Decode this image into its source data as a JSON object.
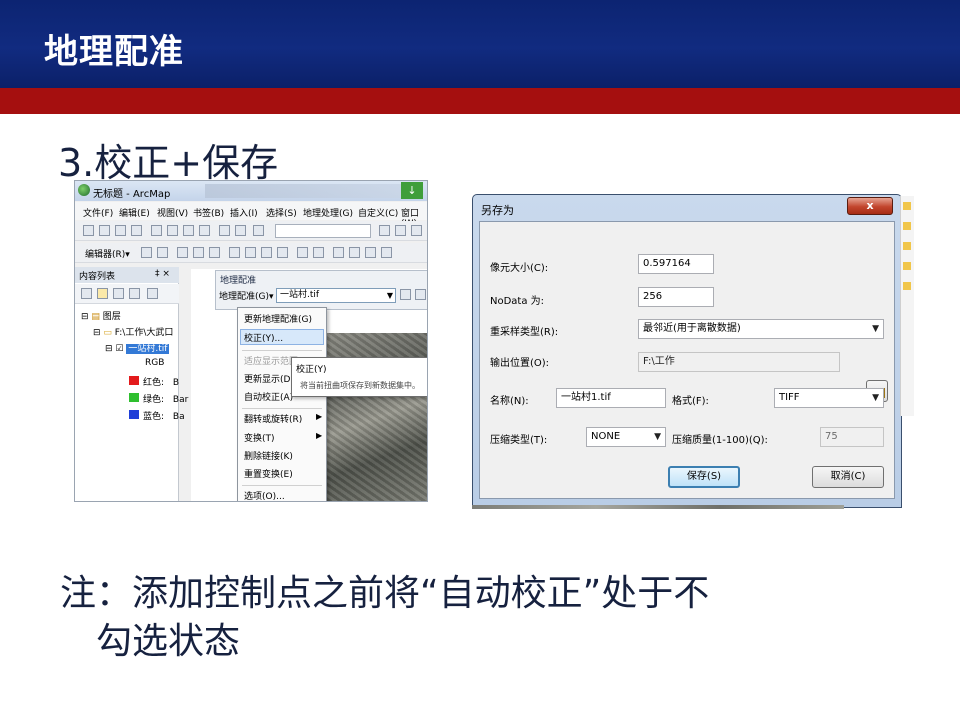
{
  "slide": {
    "title": "地理配准",
    "subtitle": "3.校正+保存",
    "note_line1": "注：添加控制点之前将“自动校正”处于不",
    "note_line2": "勾选状态",
    "colors": {
      "header": "#112b80",
      "band": "#a50f0f",
      "text": "#16213f"
    }
  },
  "arcmap": {
    "window_title": "无标题 - ArcMap",
    "menu": [
      "文件(F)",
      "编辑(E)",
      "视图(V)",
      "书签(B)",
      "插入(I)",
      "选择(S)",
      "地理处理(G)",
      "自定义(C)",
      "窗口(W)"
    ],
    "editor_label": "编辑器(R)▾",
    "toc": {
      "header": "内容列表",
      "pin": "‡ ×",
      "layers": "图层",
      "folder": "F:\\工作\\大武口",
      "raster": "一站村.tif",
      "rgb": "RGB",
      "bands": [
        {
          "label": "红色:",
          "value": "B",
          "color": "#e31a1c"
        },
        {
          "label": "绿色:",
          "value": "Bar",
          "color": "#2fbf2f"
        },
        {
          "label": "蓝色:",
          "value": "Ba",
          "color": "#1f3fd8"
        }
      ]
    },
    "georef": {
      "toolbar_title": "地理配准",
      "button": "地理配准(G)▾",
      "layer_combo": "一站村.tif",
      "menu_items": [
        "更新地理配准(G)",
        "校正(Y)...",
        "适应显示范围",
        "更新显示(D)",
        "自动校正(A)",
        "翻转或旋转(R)",
        "变换(T)",
        "删除链接(K)",
        "重置变换(E)",
        "选项(O)..."
      ],
      "tooltip_title": "校正(Y)",
      "tooltip_desc": "将当前扭曲项保存到新数据集中。"
    }
  },
  "save_dialog": {
    "title": "另存为",
    "close": "x",
    "cell_size_label": "像元大小(C):",
    "cell_size_value": "0.597164",
    "nodata_label": "NoData 为:",
    "nodata_value": "256",
    "resample_label": "重采样类型(R):",
    "resample_value": "最邻近(用于离散数据)",
    "output_label": "输出位置(O):",
    "output_value": "F:\\工作",
    "name_label": "名称(N):",
    "name_value": "一站村1.tif",
    "format_label": "格式(F):",
    "format_value": "TIFF",
    "compress_label": "压缩类型(T):",
    "compress_value": "NONE",
    "quality_label": "压缩质量(1-100)(Q):",
    "quality_value": "75",
    "save_button": "保存(S)",
    "cancel_button": "取消(C)"
  }
}
